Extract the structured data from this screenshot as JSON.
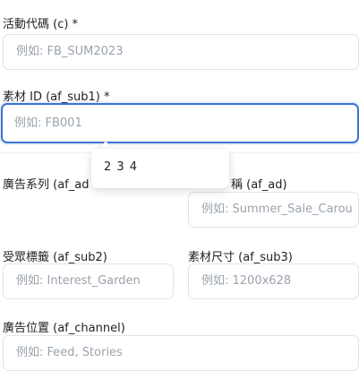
{
  "fields": {
    "campaign_code": {
      "label": "活動代碼 (c) *",
      "placeholder": "例如: FB_SUM2023"
    },
    "creative_id": {
      "label": "素材 ID (af_sub1) *",
      "placeholder": "例如: FB001"
    },
    "ad_series": {
      "label": "廣告系列 (af_ad"
    },
    "ad_name": {
      "label": "稱 (af_ad)",
      "placeholder": "例如: Summer_Sale_Carou"
    },
    "audience_tag": {
      "label": "受眾標籤 (af_sub2)",
      "placeholder": "例如: Interest_Garden"
    },
    "creative_size": {
      "label": "素材尺寸 (af_sub3)",
      "placeholder": "例如: 1200x628"
    },
    "ad_placement": {
      "label": "廣告位置 (af_channel)",
      "placeholder": "例如: Feed, Stories"
    }
  },
  "popup": {
    "text": "2 3 4"
  }
}
